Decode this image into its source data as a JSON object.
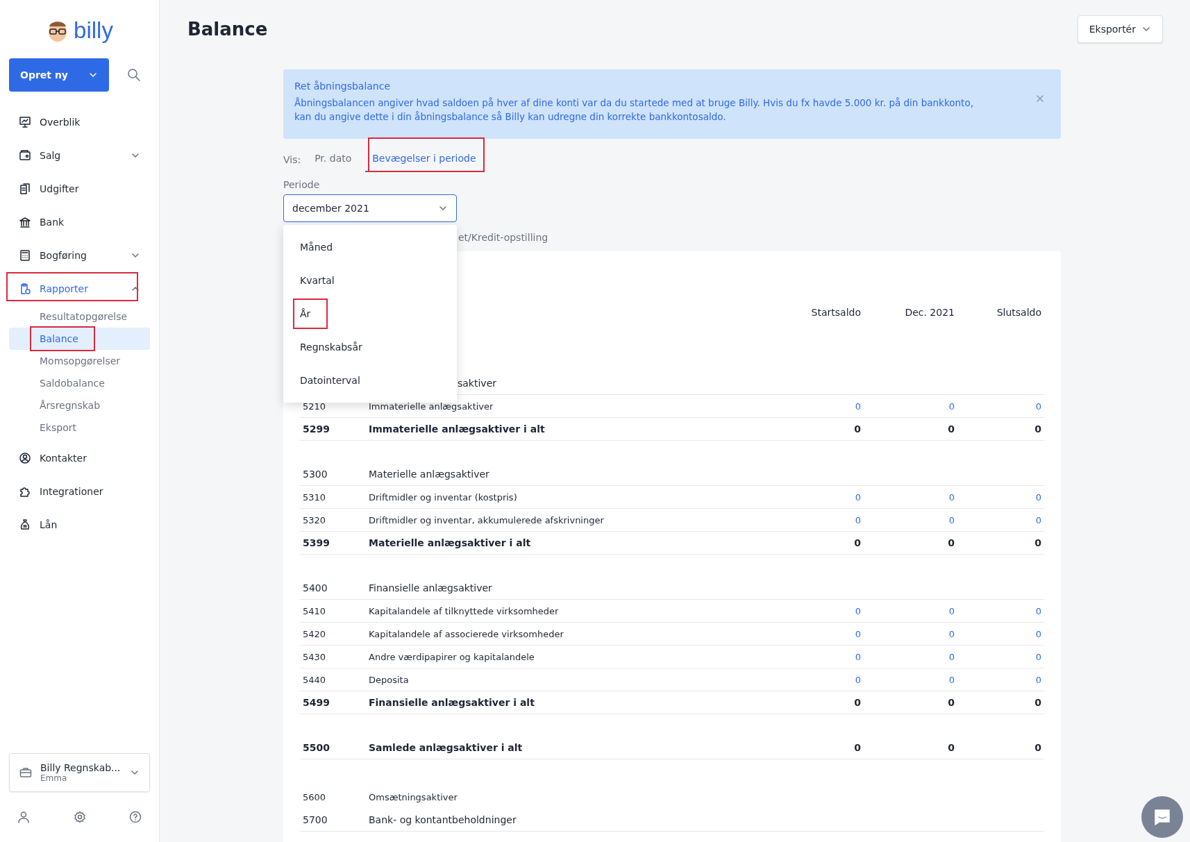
{
  "sidebar": {
    "logo": "billy",
    "create_button": "Opret ny",
    "items": [
      {
        "label": "Overblik",
        "selected": false,
        "highlighted": false
      },
      {
        "label": "Salg",
        "expanded": false,
        "selected": false,
        "highlighted": false
      },
      {
        "label": "Udgifter",
        "selected": false,
        "highlighted": false
      },
      {
        "label": "Bank",
        "selected": false,
        "highlighted": false
      },
      {
        "label": "Bogføring",
        "expanded": false,
        "selected": false,
        "highlighted": false
      },
      {
        "label": "Rapporter",
        "expanded": true,
        "selected": true,
        "highlighted": true,
        "children": [
          {
            "label": "Resultatopgørelse",
            "selected": false,
            "highlighted": false
          },
          {
            "label": "Balance",
            "selected": true,
            "highlighted": true
          },
          {
            "label": "Momsopgørelser",
            "selected": false,
            "highlighted": false
          },
          {
            "label": "Saldobalance",
            "selected": false,
            "highlighted": false
          },
          {
            "label": "Årsregnskab",
            "selected": false,
            "highlighted": false
          },
          {
            "label": "Eksport",
            "selected": false,
            "highlighted": false
          }
        ]
      },
      {
        "label": "Kontakter",
        "selected": false,
        "highlighted": false
      },
      {
        "label": "Integrationer",
        "selected": false,
        "highlighted": false
      },
      {
        "label": "Lån",
        "selected": false,
        "highlighted": false
      }
    ],
    "organization": {
      "name": "Billy Regnskab...",
      "user": "Emma"
    }
  },
  "header": {
    "title": "Balance",
    "export_button": "Eksportér"
  },
  "banner": {
    "title": "Ret åbningsbalance",
    "text": "Åbningsbalancen angiver hvad saldoen på hver af dine konti var da du startede med at bruge Billy. Hvis du fx havde 5.000 kr. på din bankkonto, kan du angive dette i din åbningsbalance så Billy kan udregne din korrekte bankkontosaldo."
  },
  "view": {
    "label": "Vis:",
    "tabs": [
      {
        "label": "Pr. dato",
        "selected": false,
        "highlighted": false
      },
      {
        "label": "Bevægelser i periode",
        "selected": true,
        "highlighted": true
      }
    ]
  },
  "period": {
    "label": "Periode",
    "value": "december 2021",
    "options": [
      {
        "label": "Måned",
        "highlighted": false
      },
      {
        "label": "Kvartal",
        "highlighted": false
      },
      {
        "label": "År",
        "highlighted": true
      },
      {
        "label": "Regnskabsår",
        "highlighted": false
      },
      {
        "label": "Datointerval",
        "highlighted": false
      }
    ]
  },
  "option_text": "et/Kredit-opstilling",
  "table": {
    "columns": [
      "Startsaldo",
      "Dec. 2021",
      "Slutsaldo"
    ],
    "rows": [
      {
        "kind": "heading",
        "code": "",
        "name": "saktiver",
        "values": []
      },
      {
        "kind": "account",
        "code": "5210",
        "name": "Immaterielle anlægsaktiver",
        "values": [
          "0",
          "0",
          "0"
        ]
      },
      {
        "kind": "total",
        "code": "5299",
        "name": "Immaterielle anlægsaktiver i alt",
        "values": [
          "0",
          "0",
          "0"
        ]
      },
      {
        "kind": "heading",
        "code": "5300",
        "name": "Materielle anlægsaktiver",
        "values": []
      },
      {
        "kind": "account",
        "code": "5310",
        "name": "Driftmidler og inventar (kostpris)",
        "values": [
          "0",
          "0",
          "0"
        ]
      },
      {
        "kind": "account",
        "code": "5320",
        "name": "Driftmidler og inventar, akkumulerede afskrivninger",
        "values": [
          "0",
          "0",
          "0"
        ]
      },
      {
        "kind": "total",
        "code": "5399",
        "name": "Materielle anlægsaktiver i alt",
        "values": [
          "0",
          "0",
          "0"
        ]
      },
      {
        "kind": "heading",
        "code": "5400",
        "name": "Finansielle anlægsaktiver",
        "values": []
      },
      {
        "kind": "account",
        "code": "5410",
        "name": "Kapitalandele af tilknyttede virksomheder",
        "values": [
          "0",
          "0",
          "0"
        ]
      },
      {
        "kind": "account",
        "code": "5420",
        "name": "Kapitalandele af associerede virksomheder",
        "values": [
          "0",
          "0",
          "0"
        ]
      },
      {
        "kind": "account",
        "code": "5430",
        "name": "Andre værdipapirer og kapitalandele",
        "values": [
          "0",
          "0",
          "0"
        ]
      },
      {
        "kind": "account",
        "code": "5440",
        "name": "Deposita",
        "values": [
          "0",
          "0",
          "0"
        ]
      },
      {
        "kind": "total",
        "code": "5499",
        "name": "Finansielle anlægsaktiver i alt",
        "values": [
          "0",
          "0",
          "0"
        ]
      },
      {
        "kind": "grand_total",
        "code": "5500",
        "name": "Samlede anlægsaktiver i alt",
        "values": [
          "0",
          "0",
          "0"
        ]
      },
      {
        "kind": "group",
        "code": "5600",
        "name": "Omsætningsaktiver",
        "values": []
      },
      {
        "kind": "heading",
        "code": "5700",
        "name": "Bank- og kontantbeholdninger",
        "values": []
      }
    ]
  }
}
